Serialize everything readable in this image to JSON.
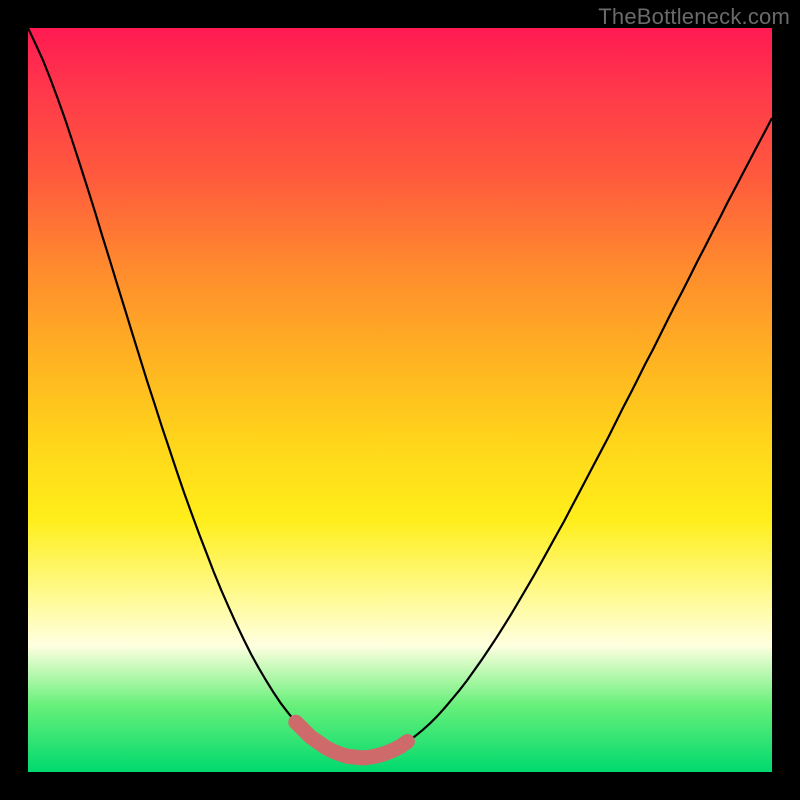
{
  "watermark": "TheBottleneck.com",
  "colors": {
    "black": "#000000",
    "curve": "#000000",
    "notch": "#cf6a6a",
    "gradient_stops": [
      "#ff1a52",
      "#ff3a4a",
      "#ff5a3d",
      "#ff8a2e",
      "#ffb122",
      "#ffd61a",
      "#ffee1a",
      "#fff982",
      "#ffffe0",
      "#68f07a",
      "#00d96e"
    ]
  },
  "chart_data": {
    "type": "line",
    "title": "",
    "xlabel": "",
    "ylabel": "",
    "xlim": [
      0,
      1
    ],
    "ylim": [
      0,
      1
    ],
    "x": [
      0.0,
      0.01,
      0.02,
      0.03,
      0.04,
      0.05,
      0.06,
      0.07,
      0.08,
      0.09,
      0.1,
      0.11,
      0.12,
      0.13,
      0.14,
      0.15,
      0.16,
      0.17,
      0.18,
      0.19,
      0.2,
      0.21,
      0.22,
      0.23,
      0.24,
      0.25,
      0.26,
      0.27,
      0.28,
      0.29,
      0.3,
      0.31,
      0.32,
      0.33,
      0.34,
      0.35,
      0.36,
      0.37,
      0.38,
      0.39,
      0.4,
      0.41,
      0.42,
      0.43,
      0.44,
      0.45,
      0.46,
      0.47,
      0.48,
      0.49,
      0.5,
      0.51,
      0.52,
      0.53,
      0.54,
      0.55,
      0.56,
      0.57,
      0.58,
      0.59,
      0.6,
      0.61,
      0.62,
      0.63,
      0.64,
      0.65,
      0.66,
      0.67,
      0.68,
      0.69,
      0.7,
      0.71,
      0.72,
      0.73,
      0.74,
      0.75,
      0.76,
      0.77,
      0.78,
      0.79,
      0.8,
      0.81,
      0.82,
      0.83,
      0.84,
      0.85,
      0.86,
      0.87,
      0.88,
      0.89,
      0.9,
      0.91,
      0.92,
      0.93,
      0.94,
      0.95,
      0.96,
      0.97,
      0.98,
      0.99,
      1.0
    ],
    "values": [
      1.0,
      0.979,
      0.957,
      0.932,
      0.905,
      0.877,
      0.847,
      0.816,
      0.785,
      0.753,
      0.72,
      0.688,
      0.655,
      0.623,
      0.59,
      0.558,
      0.526,
      0.495,
      0.464,
      0.434,
      0.404,
      0.375,
      0.347,
      0.32,
      0.294,
      0.268,
      0.244,
      0.221,
      0.199,
      0.178,
      0.158,
      0.14,
      0.123,
      0.107,
      0.092,
      0.079,
      0.067,
      0.057,
      0.047,
      0.04,
      0.033,
      0.028,
      0.024,
      0.021,
      0.02,
      0.019,
      0.02,
      0.022,
      0.025,
      0.029,
      0.034,
      0.041,
      0.048,
      0.056,
      0.065,
      0.075,
      0.086,
      0.098,
      0.11,
      0.123,
      0.137,
      0.151,
      0.166,
      0.181,
      0.197,
      0.213,
      0.23,
      0.247,
      0.264,
      0.282,
      0.3,
      0.318,
      0.336,
      0.355,
      0.374,
      0.393,
      0.412,
      0.431,
      0.45,
      0.47,
      0.49,
      0.509,
      0.529,
      0.549,
      0.568,
      0.588,
      0.608,
      0.628,
      0.647,
      0.667,
      0.687,
      0.706,
      0.726,
      0.745,
      0.765,
      0.784,
      0.803,
      0.822,
      0.841,
      0.86,
      0.879
    ],
    "notch": {
      "present": true,
      "x_range": [
        0.355,
        0.51
      ],
      "y_level": 0.022
    }
  }
}
